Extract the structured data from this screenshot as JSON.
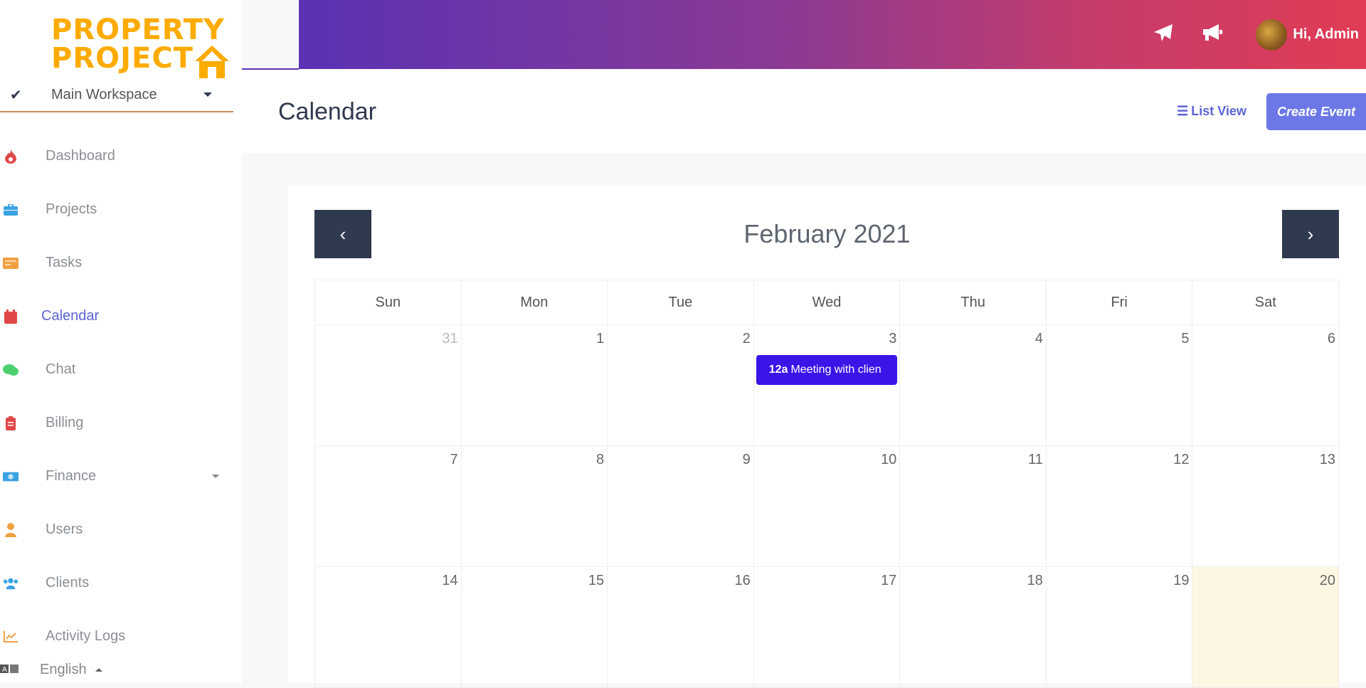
{
  "brand": {
    "line1": "PROPERTY",
    "line2": "PROJECT",
    "color": "#fdab00"
  },
  "workspace": {
    "name": "Main Workspace"
  },
  "sidebar": {
    "items": [
      {
        "label": "Dashboard",
        "icon": "fire-icon",
        "color": "#e04848"
      },
      {
        "label": "Projects",
        "icon": "briefcase-icon",
        "color": "#3aa3e3"
      },
      {
        "label": "Tasks",
        "icon": "tasks-icon",
        "color": "#f0a040"
      },
      {
        "label": "Calendar",
        "icon": "calendar-icon",
        "color": "#e04848",
        "active": true
      },
      {
        "label": "Chat",
        "icon": "chat-icon",
        "color": "#4cd070"
      },
      {
        "label": "Billing",
        "icon": "clipboard-icon",
        "color": "#e04848"
      },
      {
        "label": "Finance",
        "icon": "money-icon",
        "color": "#3aa3e3",
        "has_dropdown": true
      },
      {
        "label": "Users",
        "icon": "user-icon",
        "color": "#f0a040"
      },
      {
        "label": "Clients",
        "icon": "users-icon",
        "color": "#3aa3e3"
      },
      {
        "label": "Activity Logs",
        "icon": "chart-line-icon",
        "color": "#f0a040"
      }
    ],
    "language": "English"
  },
  "topbar": {
    "greeting": "Hi, Admin"
  },
  "page": {
    "title": "Calendar",
    "list_view_label": "List View",
    "create_event_label": "Create Event"
  },
  "calendar": {
    "month_label": "February 2021",
    "weekdays": [
      "Sun",
      "Mon",
      "Tue",
      "Wed",
      "Thu",
      "Fri",
      "Sat"
    ],
    "weeks": [
      [
        "31",
        "1",
        "2",
        "3",
        "4",
        "5",
        "6"
      ],
      [
        "7",
        "8",
        "9",
        "10",
        "11",
        "12",
        "13"
      ],
      [
        "14",
        "15",
        "16",
        "17",
        "18",
        "19",
        "20"
      ]
    ],
    "event": {
      "time": "12a",
      "title": "Meeting with clien",
      "day": "3",
      "color": "#3b14e8"
    },
    "today": "20"
  }
}
